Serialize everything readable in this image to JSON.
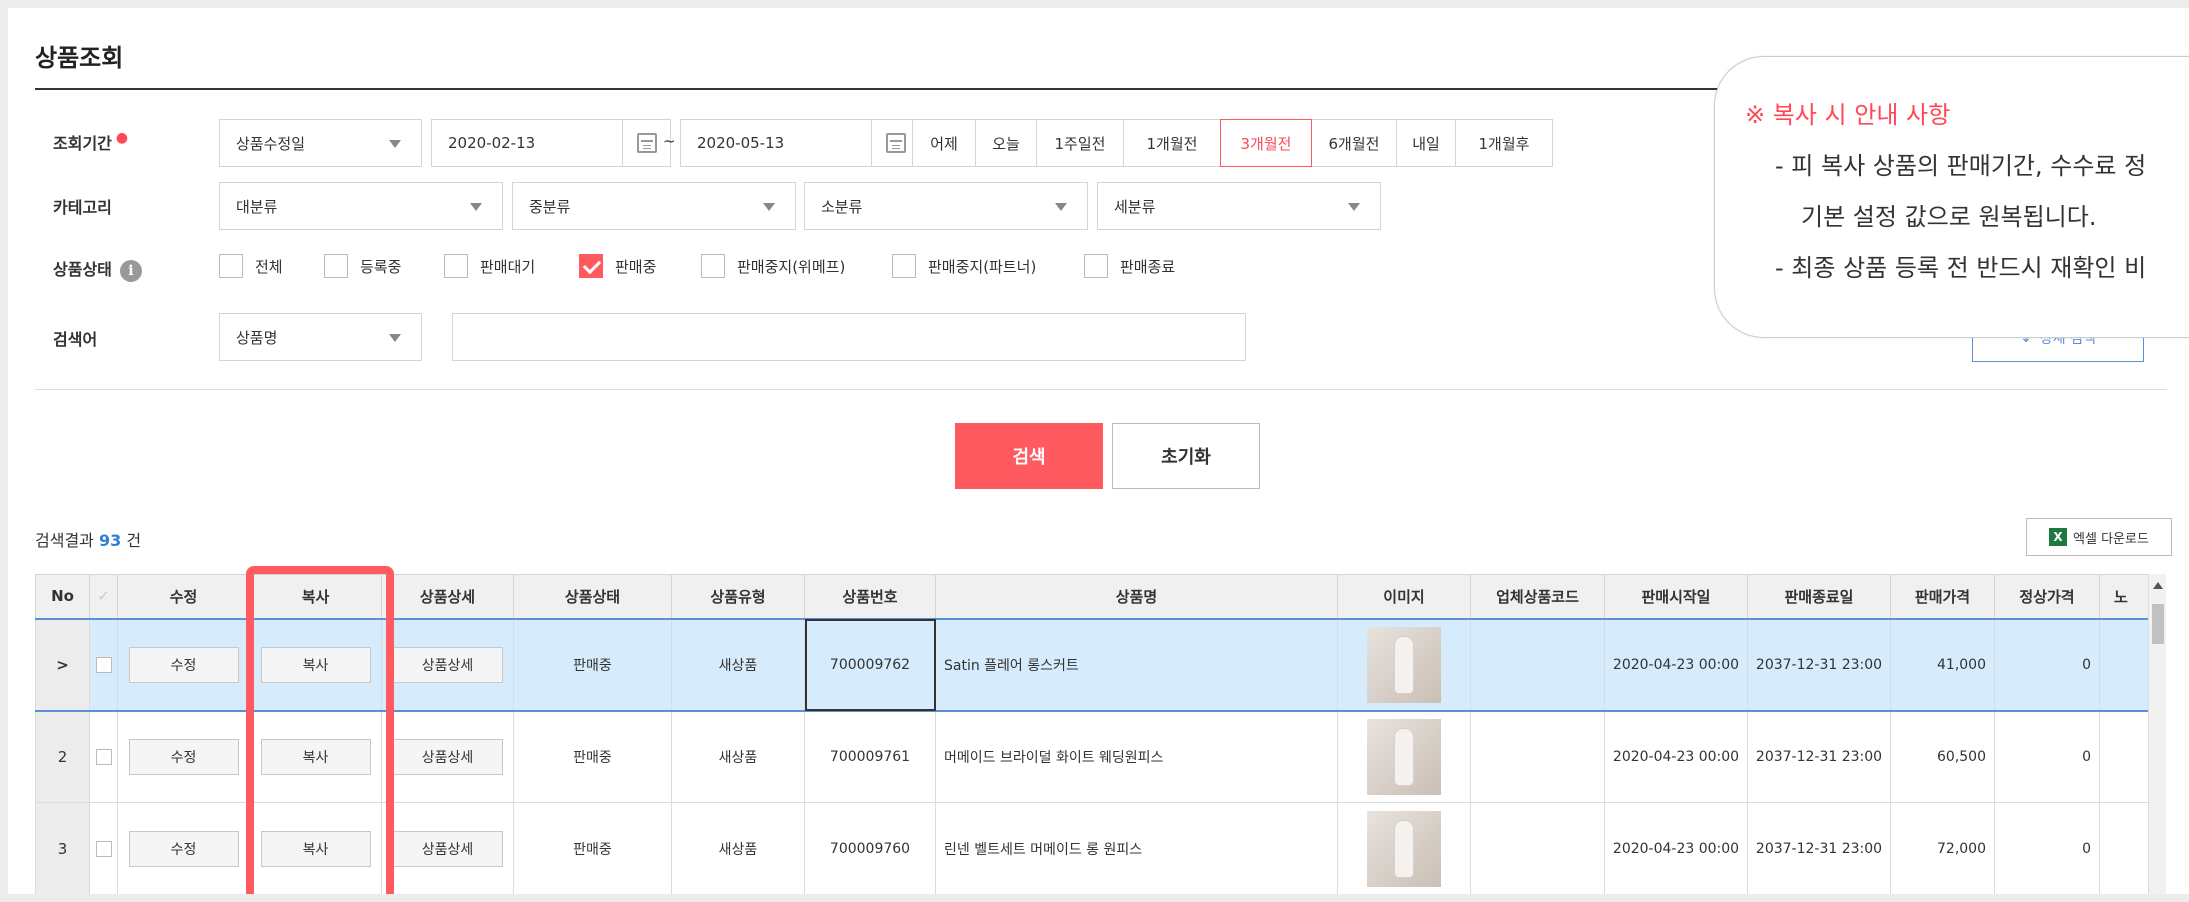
{
  "page": {
    "title": "상품조회"
  },
  "filters": {
    "period_label": "조회기간",
    "period_type": "상품수정일",
    "date_from": "2020-02-13",
    "date_sep": "~",
    "date_to": "2020-05-13",
    "quick_ranges": [
      "어제",
      "오늘",
      "1주일전",
      "1개월전",
      "3개월전",
      "6개월전",
      "내일",
      "1개월후"
    ],
    "quick_active": "3개월전",
    "category_label": "카테고리",
    "categories": [
      "대분류",
      "중분류",
      "소분류",
      "세분류"
    ],
    "status_label": "상품상태",
    "status_options": [
      {
        "label": "전체",
        "checked": false
      },
      {
        "label": "등록중",
        "checked": false
      },
      {
        "label": "판매대기",
        "checked": false
      },
      {
        "label": "판매중",
        "checked": true
      },
      {
        "label": "판매중지(위메프)",
        "checked": false
      },
      {
        "label": "판매중지(파트너)",
        "checked": false
      },
      {
        "label": "판매종료",
        "checked": false
      }
    ],
    "keyword_label": "검색어",
    "keyword_type": "상품명",
    "detail_search": "상세 검색"
  },
  "actions": {
    "search": "검색",
    "reset": "초기화"
  },
  "results": {
    "prefix": "검색결과",
    "count": "93",
    "suffix": "건",
    "excel": "엑셀 다운로드"
  },
  "table": {
    "headers": [
      "No",
      "",
      "수정",
      "복사",
      "상품상세",
      "상품상태",
      "상품유형",
      "상품번호",
      "상품명",
      "이미지",
      "업체상품코드",
      "판매시작일",
      "판매종료일",
      "판매가격",
      "정상가격",
      "노"
    ],
    "rows": [
      {
        "no": ">",
        "edit": "수정",
        "copy": "복사",
        "detail": "상품상세",
        "status": "판매중",
        "type": "새상품",
        "id": "700009762",
        "name": "Satin 플레어 롱스커트",
        "code": "",
        "start": "2020-04-23 00:00",
        "end": "2037-12-31 23:00",
        "price": "41,000",
        "list_price": "0"
      },
      {
        "no": "2",
        "edit": "수정",
        "copy": "복사",
        "detail": "상품상세",
        "status": "판매중",
        "type": "새상품",
        "id": "700009761",
        "name": "머메이드 브라이덜 화이트 웨딩원피스",
        "code": "",
        "start": "2020-04-23 00:00",
        "end": "2037-12-31 23:00",
        "price": "60,500",
        "list_price": "0"
      },
      {
        "no": "3",
        "edit": "수정",
        "copy": "복사",
        "detail": "상품상세",
        "status": "판매중",
        "type": "새상품",
        "id": "700009760",
        "name": "린넨 벨트세트 머메이드 롱 원피스",
        "code": "",
        "start": "2020-04-23 00:00",
        "end": "2037-12-31 23:00",
        "price": "72,000",
        "list_price": "0"
      }
    ]
  },
  "notice": {
    "title": "※ 복사 시 안내 사항",
    "line1": "- 피 복사 상품의 판매기간, 수수료 정",
    "line2": "기본 설정 값으로 원복됩니다.",
    "line3": "- 최종 상품 등록 전 반드시 재확인 비"
  },
  "colors": {
    "accent": "#ff5a5f",
    "link_blue": "#2e7fd6",
    "selected_row": "#d6ebfb"
  }
}
